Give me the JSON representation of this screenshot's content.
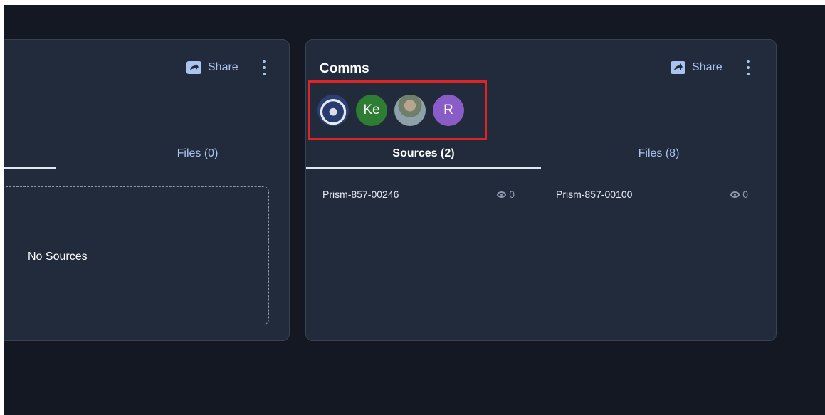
{
  "cards": [
    {
      "title": "",
      "share_label": "Share",
      "tabs": {
        "files": "Files (0)"
      },
      "empty_text": "No Sources"
    },
    {
      "title": "Comms",
      "share_label": "Share",
      "avatars": [
        {
          "type": "photo",
          "label": ""
        },
        {
          "type": "initials",
          "label": "Ke"
        },
        {
          "type": "photo",
          "label": ""
        },
        {
          "type": "initials",
          "label": "R"
        }
      ],
      "tabs": {
        "sources": "Sources (2)",
        "files": "Files (8)"
      },
      "sources": [
        {
          "name": "Prism-857-00246",
          "views": "0"
        },
        {
          "name": "Prism-857-00100",
          "views": "0"
        }
      ]
    }
  ],
  "colors": {
    "background": "#131823",
    "card": "#222b3b",
    "accent": "#a9c4ef",
    "highlight": "#e02424",
    "avatar_ke": "#2e7d32",
    "avatar_r": "#8a5cc8"
  },
  "icons": [
    "share-icon",
    "kebab-menu-icon",
    "eye-icon"
  ]
}
